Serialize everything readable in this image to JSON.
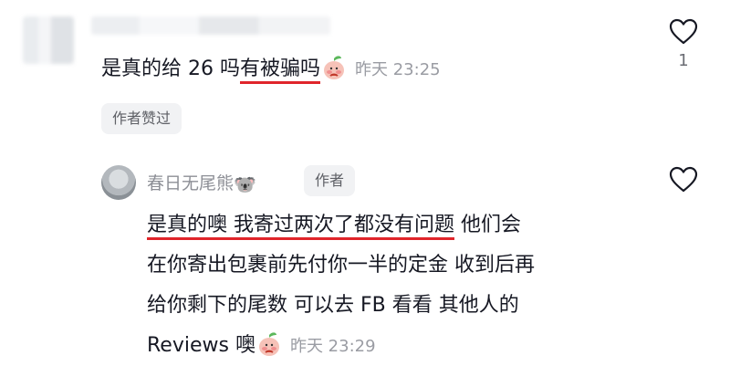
{
  "comment": {
    "text_plain": "是真的给 26 吗",
    "text_highlight": "有被骗吗",
    "emoji": "peach-emoji",
    "time": "昨天 23:25",
    "liked_by_author": "作者赞过",
    "like_count": "1"
  },
  "reply": {
    "author_name": "春日无尾熊",
    "author_emoji": "🐨",
    "author_badge": "作者",
    "line1_highlight": "是真的噢 我寄过两次了都没有问题",
    "line1_rest": " 他们会",
    "line2": "在你寄出包裹前先付你一半的定金 收到后再",
    "line3": "给你剩下的尾数 可以去 FB 看看 其他人的",
    "line4": "Reviews 噢",
    "emoji": "peach-emoji",
    "time": "昨天 23:29"
  },
  "colors": {
    "text": "#161823",
    "meta": "#9a9ca3",
    "highlight_underline": "#e0252b",
    "chip_bg": "#f1f2f4"
  }
}
